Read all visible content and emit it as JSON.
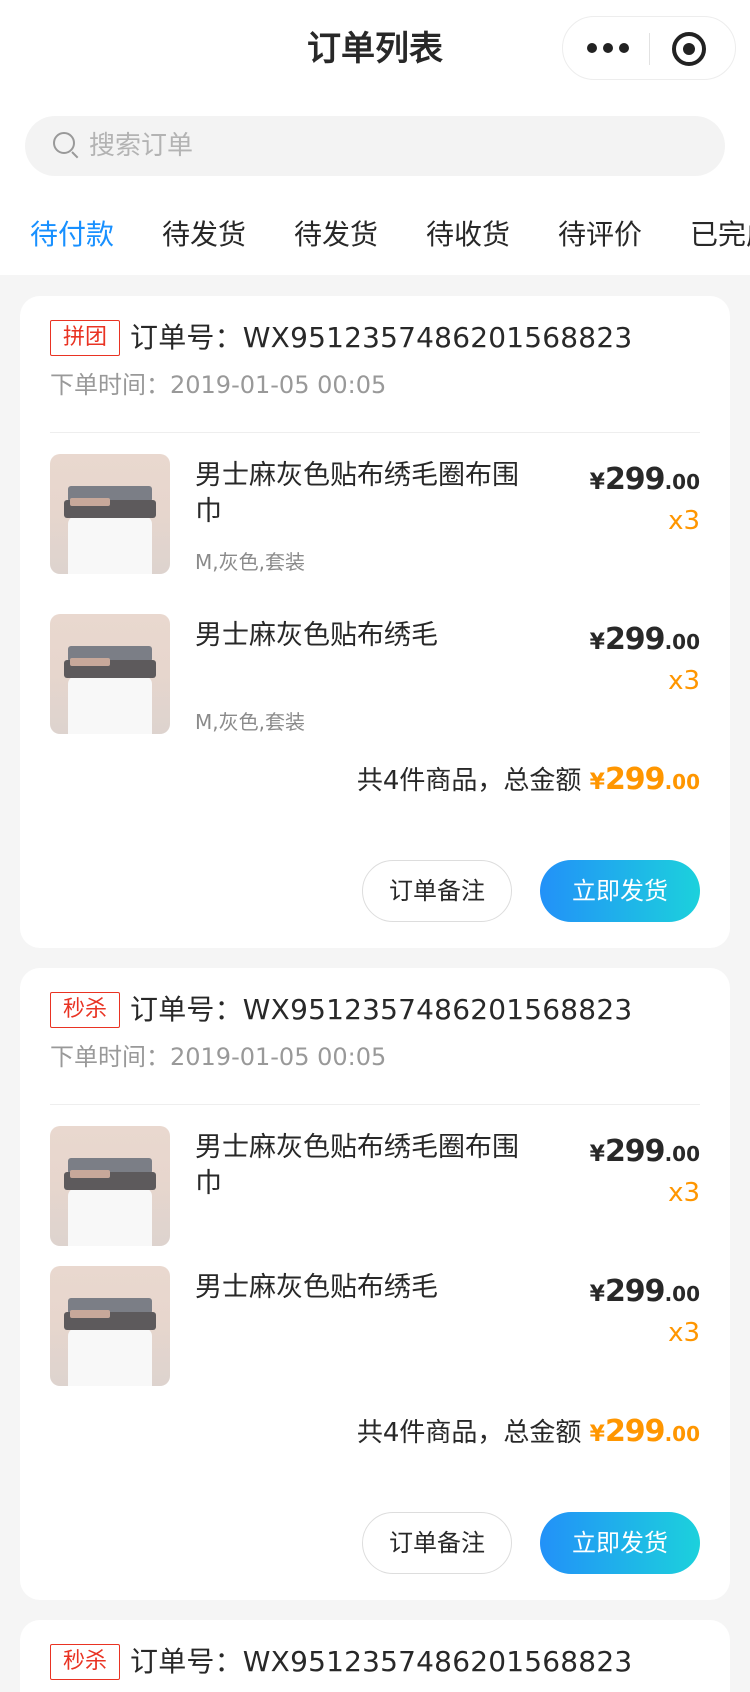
{
  "header": {
    "title": "订单列表",
    "capsule": {
      "more_icon": "more-dots-icon",
      "close_icon": "target-icon"
    }
  },
  "search": {
    "placeholder": "搜索订单",
    "icon": "search-icon"
  },
  "tabs": [
    {
      "label": "待付款",
      "active": true
    },
    {
      "label": "待发货",
      "active": false
    },
    {
      "label": "待发货",
      "active": false
    },
    {
      "label": "待收货",
      "active": false
    },
    {
      "label": "待评价",
      "active": false
    },
    {
      "label": "已完成",
      "active": false
    }
  ],
  "colors": {
    "accent": "#1890ff",
    "price": "#ff9600",
    "badge": "#e93323",
    "button_gradient": [
      "#2291f8",
      "#1cd1dc"
    ]
  },
  "orders": [
    {
      "badge": "拼团",
      "order_no": "订单号：WX9512357486201568823",
      "time": "下单时间：2019-01-05 00:05",
      "items": [
        {
          "name": "男士麻灰色贴布绣毛圈布围巾",
          "sku": "M,灰色,套装",
          "price": {
            "cur": "¥",
            "int": "299",
            "dec": ".00"
          },
          "qty": "x3"
        },
        {
          "name": "男士麻灰色贴布绣毛",
          "sku": "M,灰色,套装",
          "price": {
            "cur": "¥",
            "int": "299",
            "dec": ".00"
          },
          "qty": "x3"
        }
      ],
      "summary": {
        "label": "共4件商品，总金额",
        "cur": "¥",
        "int": "299",
        "dec": ".00"
      },
      "note_button": "订单备注",
      "ship_button": "立即发货"
    },
    {
      "badge": "秒杀",
      "order_no": "订单号：WX9512357486201568823",
      "time": "下单时间：2019-01-05 00:05",
      "items": [
        {
          "name": "男士麻灰色贴布绣毛圈布围巾",
          "sku": "",
          "price": {
            "cur": "¥",
            "int": "299",
            "dec": ".00"
          },
          "qty": "x3"
        },
        {
          "name": "男士麻灰色贴布绣毛",
          "sku": "",
          "price": {
            "cur": "¥",
            "int": "299",
            "dec": ".00"
          },
          "qty": "x3"
        }
      ],
      "summary": {
        "label": "共4件商品，总金额",
        "cur": "¥",
        "int": "299",
        "dec": ".00"
      },
      "note_button": "订单备注",
      "ship_button": "立即发货"
    },
    {
      "badge": "秒杀",
      "order_no": "订单号：WX9512357486201568823"
    }
  ]
}
